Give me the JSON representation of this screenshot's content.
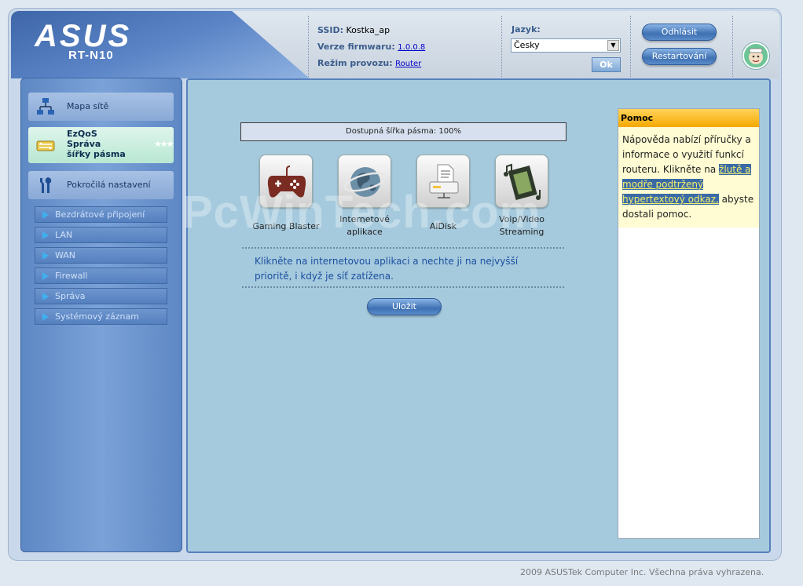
{
  "brand": {
    "logo": "ASUS",
    "model": "RT-N10"
  },
  "status": {
    "ssid_label": "SSID:",
    "ssid_value": "Kostka_ap",
    "firmware_label": "Verze firmwaru:",
    "firmware_value": "1.0.0.8",
    "mode_label": "Režim provozu:",
    "mode_value": "Router"
  },
  "language": {
    "label": "Jazyk:",
    "selected": "Česky",
    "ok_label": "Ok"
  },
  "header_buttons": {
    "logout": "Odhlásit",
    "restart": "Restartování"
  },
  "sidebar": {
    "map_label": "Mapa sítě",
    "qos_label_1": "EzQoS",
    "qos_label_2": "Správa",
    "qos_label_3": "šířky pásma",
    "advanced_label": "Pokročilá nastavení",
    "sub_items": [
      "Bezdrátové připojení",
      "LAN",
      "WAN",
      "Firewall",
      "Správa",
      "Systémový záznam"
    ]
  },
  "main": {
    "bandwidth": "Dostupná šířka pásma: 100%",
    "apps": [
      {
        "label_1": "Gaming Blaster",
        "label_2": ""
      },
      {
        "label_1": "Internetové",
        "label_2": "aplikace"
      },
      {
        "label_1": "AiDisk",
        "label_2": ""
      },
      {
        "label_1": "Voip/Video",
        "label_2": "Streaming"
      }
    ],
    "description_1": "Klikněte na internetovou aplikaci a nechte ji na nejvyšší",
    "description_2": "prioritě, i když je síť zatížena.",
    "save_label": "Uložit"
  },
  "help": {
    "title": "Pomoc",
    "text_1": "Nápověda nabízí příručky a informace o využití funkcí routeru. Klikněte na ",
    "link": "žlutě a modře podtržený hypertextový odkaz,",
    "text_2": " abyste dostali pomoc."
  },
  "watermark": "PcWinTech.com",
  "footer": "2009 ASUSTek Computer Inc. Všechna práva vyhrazena.",
  "colors": {
    "accent": "#3e71b3",
    "qos_active": "#b8e7d2",
    "help_title": "#f5a800"
  }
}
